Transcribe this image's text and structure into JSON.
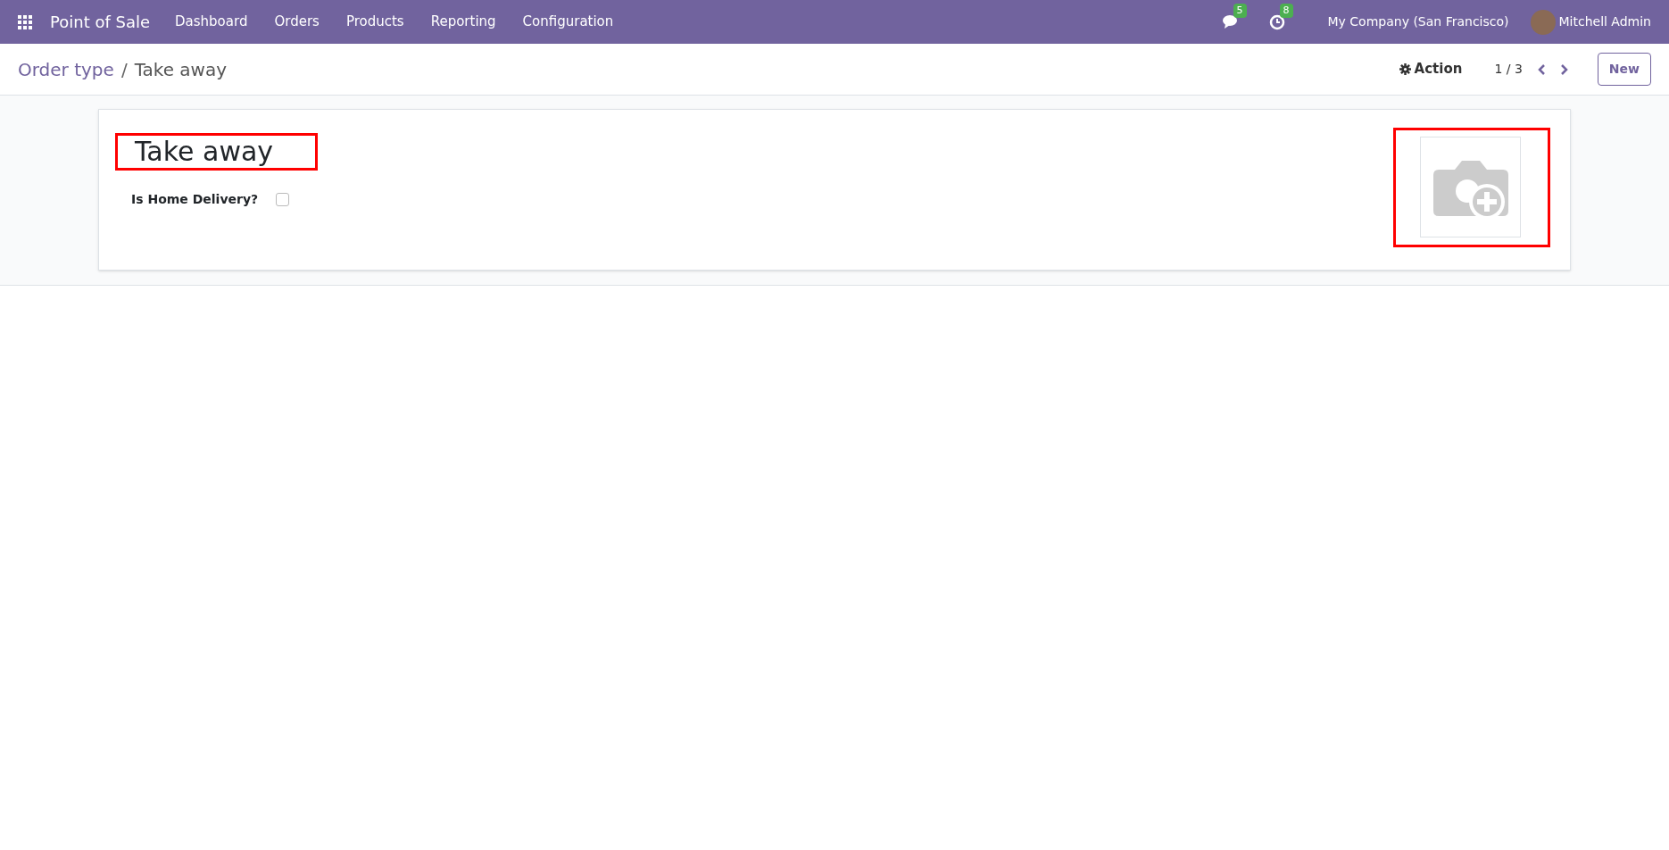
{
  "navbar": {
    "app_name": "Point of Sale",
    "menu": [
      "Dashboard",
      "Orders",
      "Products",
      "Reporting",
      "Configuration"
    ],
    "messages_count": "5",
    "activities_count": "8",
    "company": "My Company (San Francisco)",
    "user": "Mitchell Admin"
  },
  "control_panel": {
    "breadcrumb": [
      "Order type",
      "Take away"
    ],
    "breadcrumb_separator": "/",
    "action": "Action",
    "pager": "1 / 3",
    "new_button": "New"
  },
  "form": {
    "name": "Take away",
    "fields": [
      {
        "label": "Is Home Delivery?",
        "checked": false
      }
    ]
  }
}
